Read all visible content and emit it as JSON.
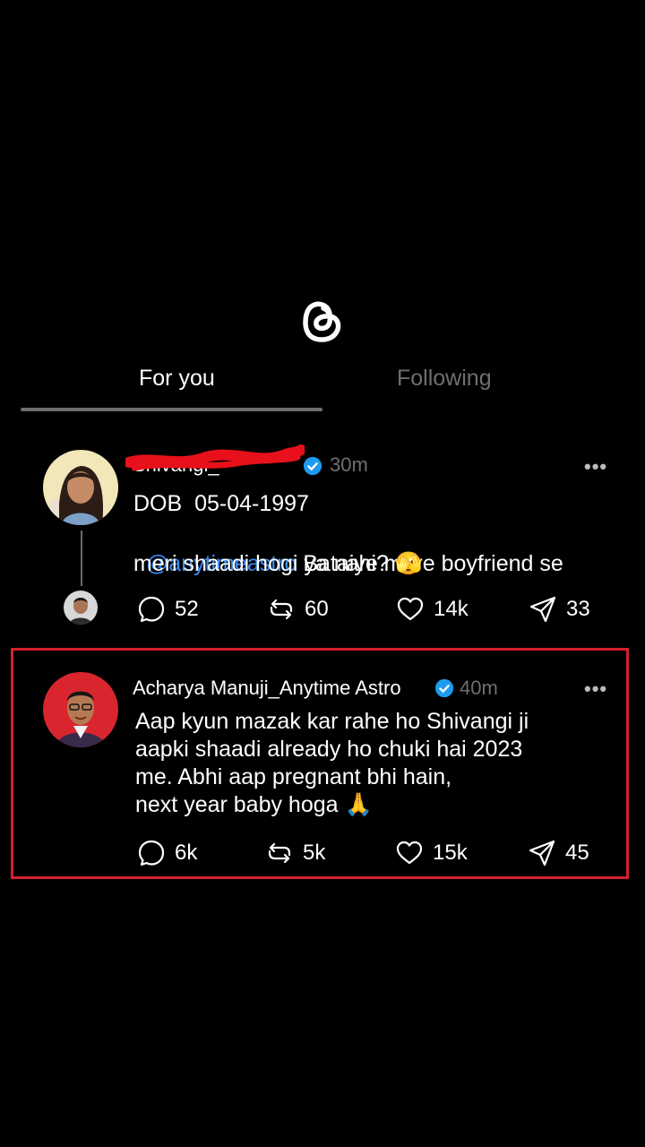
{
  "header": {
    "logo_icon": "threads-logo-icon"
  },
  "tabs": [
    {
      "label": "For you",
      "active": true
    },
    {
      "label": "Following",
      "active": false
    }
  ],
  "post1": {
    "username": "Shivangi_",
    "username_obscured": true,
    "verified": true,
    "time": "30m",
    "line1": "DOB  05-04-1997",
    "mention": "@anytimeastro",
    "text_a": " Bataiye mere boyfriend se",
    "text_b": "meri shaadi hogi ya nahi? 🫣",
    "stats": {
      "replies": "52",
      "reposts": "60",
      "likes": "14k",
      "shares": "33"
    }
  },
  "post2": {
    "username": "Acharya Manuji_Anytime Astro",
    "verified": true,
    "time": "40m",
    "lines": [
      "Aap kyun mazak kar rahe ho Shivangi ji",
      "aapki shaadi already ho chuki hai 2023",
      "me. Abhi aap pregnant bhi hain,",
      "next year baby hoga 🙏"
    ],
    "stats": {
      "replies": "6k",
      "reposts": "5k",
      "likes": "15k",
      "shares": "45"
    }
  },
  "colors": {
    "background": "#000000",
    "mention": "#3e8cf7",
    "verified": "#1d9bf0",
    "highlight_border": "#d5202a",
    "scribble": "#e8101a"
  }
}
